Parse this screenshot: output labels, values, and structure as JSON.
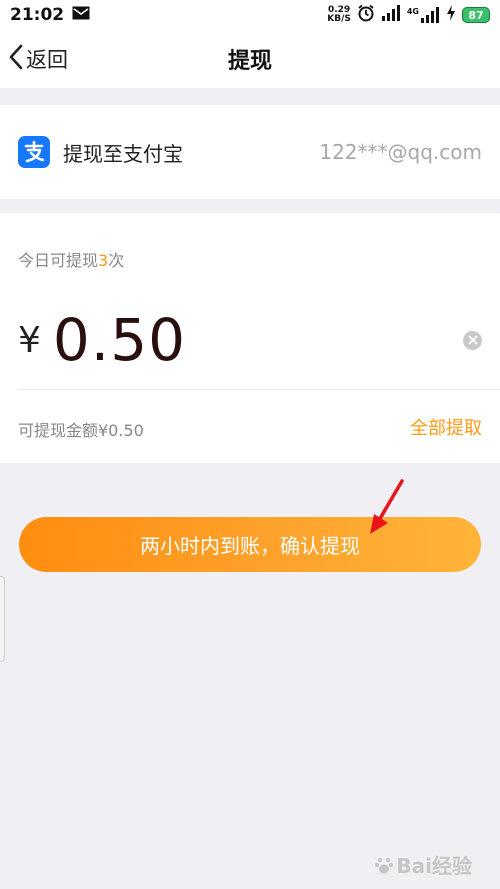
{
  "status_bar": {
    "time": "21:02",
    "net_speed_value": "0.29",
    "net_speed_unit": "KB/S",
    "network_label": "4G",
    "battery": "87",
    "battery_color": "#39c06b"
  },
  "nav": {
    "back_label": "返回",
    "title": "提现"
  },
  "alipay": {
    "label": "提现至支付宝",
    "account": "122***@qq.com",
    "logo_icon": "alipay-icon",
    "logo_color": "#1677ff"
  },
  "withdraw": {
    "times_prefix": "今日可提现",
    "times_count": "3",
    "times_suffix": "次",
    "currency": "¥",
    "amount": "0.50",
    "available_label": "可提现金额¥0.50",
    "withdraw_all": "全部提取",
    "accent_color": "#ff9a17"
  },
  "confirm": {
    "label": "两小时内到账，确认提现"
  },
  "watermark": {
    "text": "Bai经验"
  }
}
